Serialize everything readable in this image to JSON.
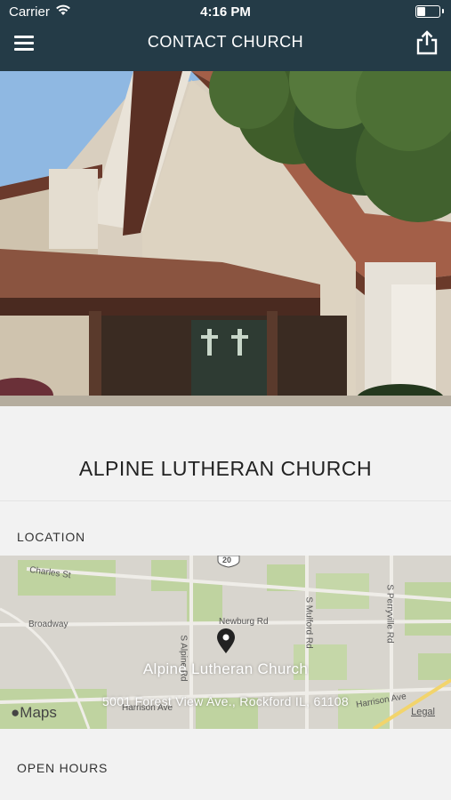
{
  "status_bar": {
    "carrier": "Carrier",
    "time": "4:16 PM"
  },
  "nav": {
    "title": "CONTACT CHURCH"
  },
  "church": {
    "name": "ALPINE LUTHERAN CHURCH"
  },
  "location": {
    "label": "LOCATION",
    "map": {
      "place_name": "Alpine Lutheran Church",
      "address": "5001 Forest View Ave., Rockford IL, 61108",
      "logo": "Maps",
      "legal": "Legal",
      "roads": [
        "Charles St",
        "Broadway",
        "Newburg Rd",
        "S Alpine Rd",
        "S Mulford Rd",
        "S Perryville Rd",
        "Harrison Ave",
        "Harrison Ave",
        "20"
      ]
    }
  },
  "hours": {
    "label": "OPEN HOURS"
  }
}
